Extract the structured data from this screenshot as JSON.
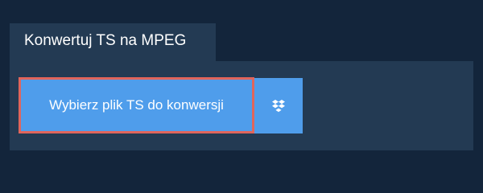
{
  "tab": {
    "title": "Konwertuj TS na MPEG"
  },
  "upload": {
    "choose_file_label": "Wybierz plik TS do konwersji",
    "dropbox_icon": "dropbox-icon"
  },
  "colors": {
    "page_background": "#13253b",
    "panel_background": "#233a53",
    "button_background": "#4f9deb",
    "focus_outline": "#e0655c",
    "text": "#ffffff"
  }
}
